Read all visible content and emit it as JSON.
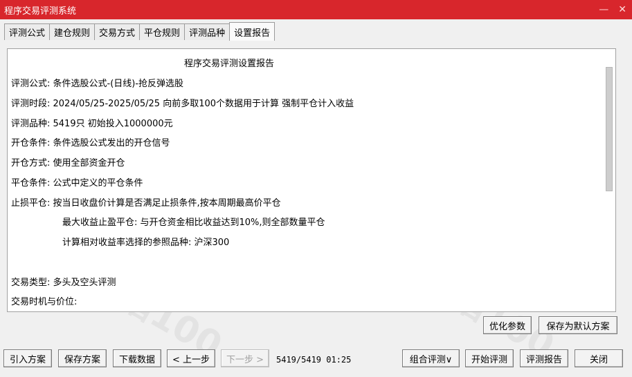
{
  "window": {
    "title": "程序交易评测系统",
    "minimize": "—",
    "close": "✕"
  },
  "tabs": [
    "评测公式",
    "建仓规则",
    "交易方式",
    "平仓规则",
    "评测品种",
    "设置报告"
  ],
  "report": {
    "heading": "程序交易评测设置报告",
    "lines": [
      "评测公式:  条件选股公式-(日线)-抢反弹选股",
      "评测时段:  2024/05/25-2025/05/25 向前多取100个数据用于计算 强制平仓计入收益",
      "评测品种:  5419只 初始投入1000000元",
      "开仓条件:  条件选股公式发出的开仓信号",
      "开仓方式:  使用全部资金开仓",
      "平仓条件:  公式中定义的平仓条件",
      "止损平仓:  按当日收盘价计算是否满足止损条件,按本周期最高价平仓",
      "最大收益止盈平仓:  与开仓资金相比收益达到10%,则全部数量平仓",
      "计算相对收益率选择的参照品种:  沪深300",
      "交易类型:  多头及空头评测",
      "交易时机与价位:"
    ]
  },
  "buttons": {
    "optimize": "优化参数",
    "save_default": "保存为默认方案",
    "import": "引入方案",
    "save": "保存方案",
    "download": "下载数据",
    "prev": "< 上一步",
    "next": "下一步 >",
    "combo": "组合评测∨",
    "start": "开始评测",
    "report": "评测报告",
    "close": "关闭"
  },
  "status": "5419/5419 01:25",
  "watermark": "牛指100",
  "colors": {
    "titlebar": "#d8262c"
  }
}
